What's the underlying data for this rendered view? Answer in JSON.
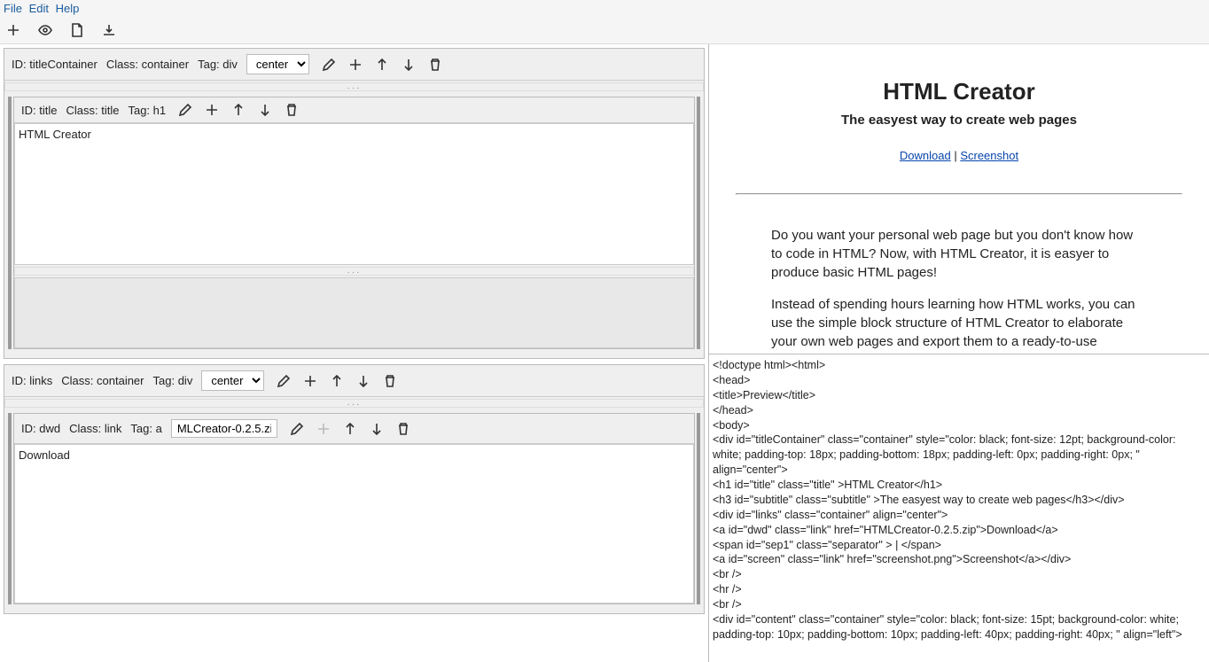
{
  "menu": {
    "file": "File",
    "edit": "Edit",
    "help": "Help"
  },
  "blocks": {
    "b1": {
      "id_label": "ID:",
      "id_val": "titleContainer",
      "class_label": "Class:",
      "class_val": "container",
      "tag_label": "Tag:",
      "tag_val": "div",
      "align": "center"
    },
    "b2": {
      "id_label": "ID:",
      "id_val": "title",
      "class_label": "Class:",
      "class_val": "title",
      "tag_label": "Tag:",
      "tag_val": "h1",
      "content": "HTML Creator"
    },
    "b3": {
      "id_label": "ID:",
      "id_val": "links",
      "class_label": "Class:",
      "class_val": "container",
      "tag_label": "Tag:",
      "tag_val": "div",
      "align": "center"
    },
    "b4": {
      "id_label": "ID:",
      "id_val": "dwd",
      "class_label": "Class:",
      "class_val": "link",
      "tag_label": "Tag:",
      "tag_val": "a",
      "href": "MLCreator-0.2.5.zip",
      "content": "Download"
    }
  },
  "preview": {
    "title": "HTML Creator",
    "subtitle": "The easyest way to create web pages",
    "link1": "Download",
    "sep": " | ",
    "link2": "Screenshot",
    "para1": "Do you want your personal web page but you don't know how to code in HTML? Now, with HTML Creator, it is easyer to produce basic HTML pages!",
    "para2": "Instead of spending hours learning how HTML works, you can use the simple block structure of HTML Creator to elaborate your own web pages and export them to a ready-to-use document. Your only worry will be upload it to your host."
  },
  "source": "<!doctype html><html>\n<head>\n<title>Preview</title>\n</head>\n<body>\n<div id=\"titleContainer\" class=\"container\" style=\"color: black; font-size: 12pt; background-color: white; padding-top: 18px; padding-bottom: 18px; padding-left: 0px; padding-right: 0px; \" align=\"center\">\n<h1 id=\"title\" class=\"title\" >HTML Creator</h1>\n<h3 id=\"subtitle\" class=\"subtitle\" >The easyest way to create web pages</h3></div>\n<div id=\"links\" class=\"container\" align=\"center\">\n<a id=\"dwd\" class=\"link\" href=\"HTMLCreator-0.2.5.zip\">Download</a>\n<span id=\"sep1\" class=\"separator\" > | </span>\n<a id=\"screen\" class=\"link\" href=\"screenshot.png\">Screenshot</a></div>\n<br />\n<hr />\n<br />\n<div id=\"content\" class=\"container\" style=\"color: black; font-size: 15pt; background-color: white; padding-top: 10px; padding-bottom: 10px; padding-left: 40px; padding-right: 40px; \" align=\"left\">"
}
